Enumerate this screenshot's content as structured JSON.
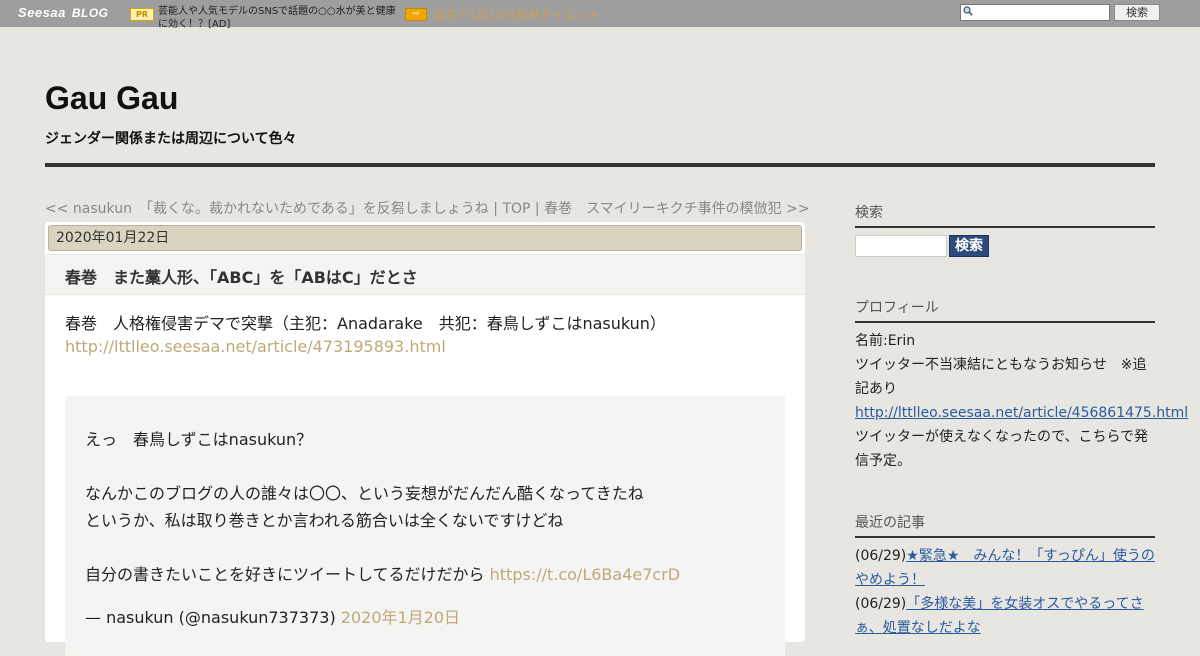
{
  "topbar": {
    "logo_main": "Seesaa",
    "logo_blog": "BLOG",
    "pr_label": "PR",
    "ad1_text": "芸能人や人気モデルのSNSで話題の○○水が美と健康に効く！？[AD]",
    "arrow_label": "⇨",
    "ad2_text": "自宅で1回10分簡単ダイエット",
    "search_value": "",
    "search_button": "検索"
  },
  "header": {
    "title": "Gau Gau",
    "description": "ジェンダー関係または周辺について色々"
  },
  "nav": {
    "prev": "<< nasukun　「裁くな。裁かれないためである」を反芻しましょうね",
    "sep1": " | ",
    "top": "TOP",
    "sep2": " | ",
    "next": "春巻　スマイリーキクチ事件の模倣犯 >>"
  },
  "article": {
    "date": "2020年01月22日",
    "title": "春巻　また藁人形、「ABC」を「ABはC」だとさ",
    "line1": "春巻　人格権侵害デマで突撃（主犯：Anadarake　共犯：春鳥しずこはnasukun）",
    "link1": "http://lttlleo.seesaa.net/article/473195893.html",
    "quote": {
      "line1": "えっ　春鳥しずこはnasukun？",
      "line2": "なんかこのブログの人の誰々は〇〇、という妄想がだんだん酷くなってきたね",
      "line3": "というか、私は取り巻きとか言われる筋合いは全くないですけどね",
      "line4": "自分の書きたいことを好きにツイートしてるだけだから",
      "line4_link": "https://t.co/L6Ba4e7crD",
      "attribution": "— nasukun (@nasukun737373)",
      "attribution_link": "2020年1月20日"
    }
  },
  "sidebar": {
    "search_heading": "検索",
    "search_value": "",
    "search_button": "検索",
    "profile_heading": "プロフィール",
    "profile_name": "名前:Erin",
    "profile_note": "ツイッター不当凍結にともなうお知らせ　※追記あり",
    "profile_link": "http://lttlleo.seesaa.net/article/456861475.html",
    "profile_note2": "ツイッターが使えなくなったので、こちらで発信予定。",
    "recent_heading": "最近の記事",
    "recent": [
      {
        "date": "(06/29)",
        "title": "★緊急★　みんな！「すっぴん」使うのやめよう！"
      },
      {
        "date": "(06/29)",
        "title": "「多様な美」を女装オスでやるってさぁ、処置なしだよな"
      }
    ]
  },
  "colors": {
    "topbar_bg": "#9e9e9e",
    "page_bg": "#e8e6e1",
    "link_tan": "#c0a878",
    "link_blue": "#2a5aa0",
    "search_button_bg": "#2d4a7a"
  }
}
